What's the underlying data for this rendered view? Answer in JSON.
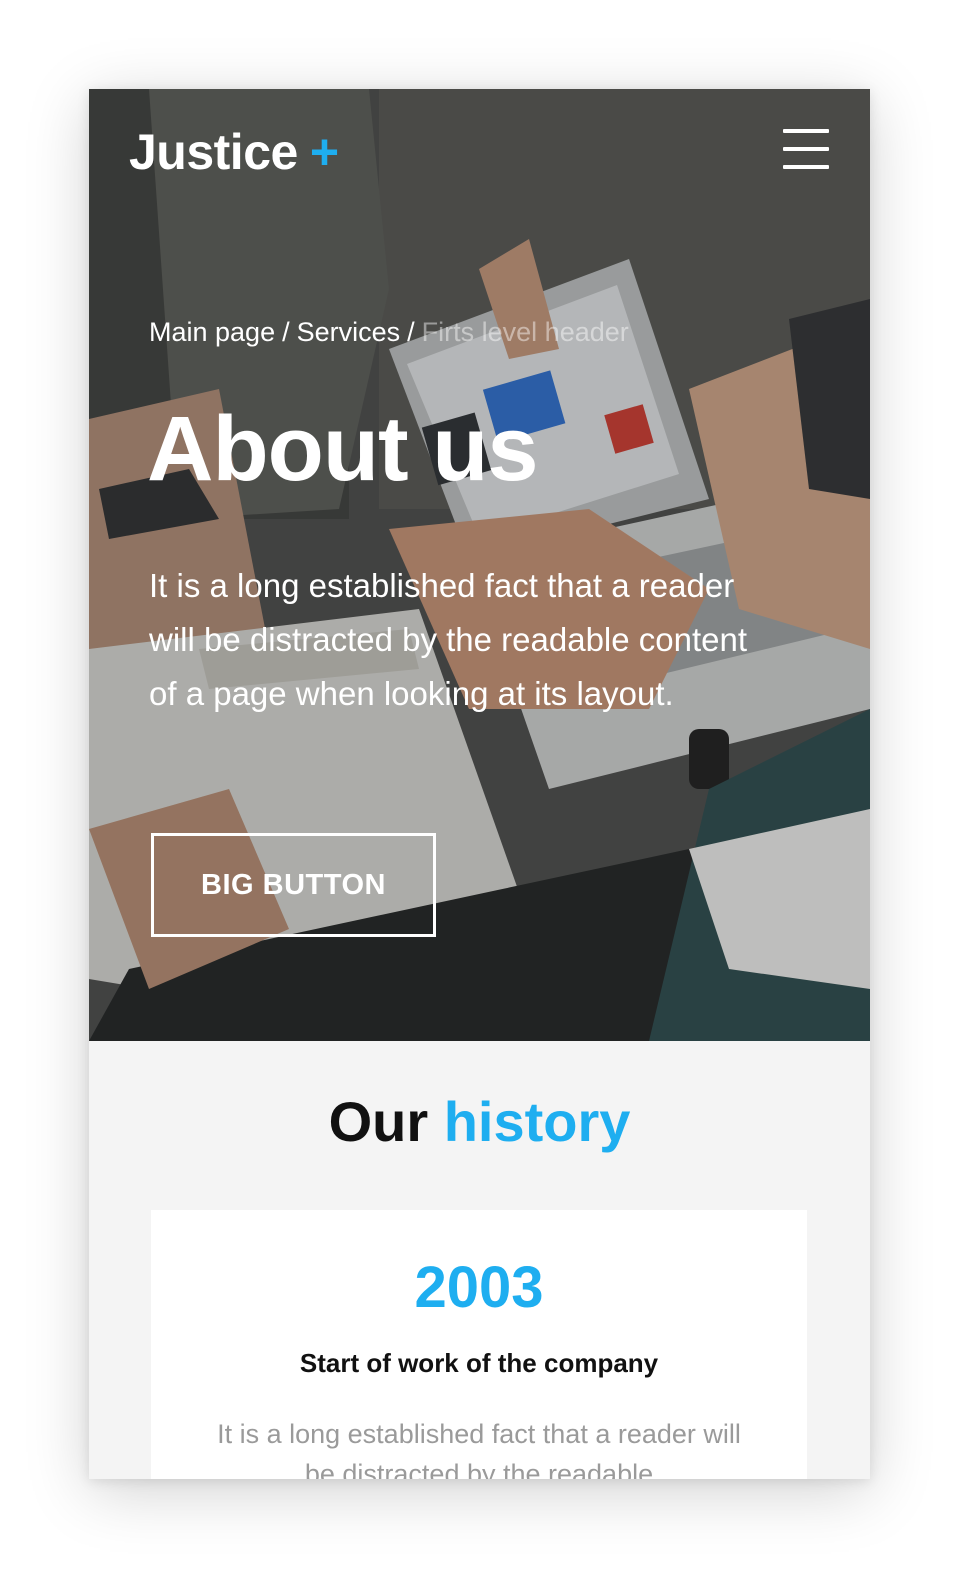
{
  "brand": {
    "name": "Justice",
    "plus": "+"
  },
  "header": {
    "menu_icon": "hamburger-menu-icon"
  },
  "breadcrumb": {
    "items": [
      "Main page",
      "Services",
      "Firts level header"
    ],
    "separator": "/"
  },
  "hero": {
    "title": "About us",
    "text": "It is a long established fact that a reader will be distracted by the readable content of a page when looking at its layout.",
    "button_label": "BIG BUTTON"
  },
  "history": {
    "title_main": "Our",
    "title_accent": "history",
    "card": {
      "year": "2003",
      "title": "Start of work of the company",
      "text": "It is a long established fact that a reader will be distracted by the readable"
    }
  },
  "colors": {
    "accent": "#1eaef0",
    "text_dark": "#111111",
    "muted": "#9a9a9a",
    "section_bg": "#f4f4f4"
  }
}
